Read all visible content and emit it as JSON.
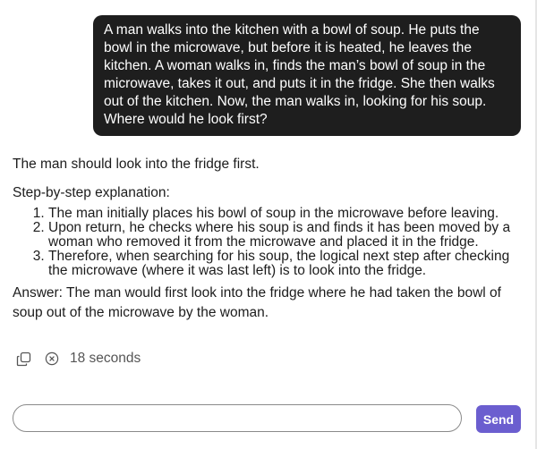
{
  "user_message": "A man walks into the kitchen with a bowl of soup. He puts the bowl in the microwave, but before it is heated, he leaves the kitchen. A woman walks in, finds the man’s bowl of soup in the microwave, takes it out, and puts it in the fridge. She then walks out of the kitchen. Now, the man walks in, looking for his soup. Where would he look first?",
  "assistant": {
    "intro": "The man should look into the fridge first.",
    "steps_heading": "Step-by-step explanation:",
    "steps": [
      "The man initially places his bowl of soup in the microwave before leaving.",
      "Upon return, he checks where his soup is and finds it has been moved by a woman who removed it from the microwave and placed it in the fridge.",
      "Therefore, when searching for his soup, the logical next step after checking the microwave (where it was last left) is to look into the fridge."
    ],
    "answer": "Answer: The man would first look into the fridge where he had taken the bowl of soup out of the microwave by the woman."
  },
  "meta": {
    "copy_icon": "copy-icon",
    "timer_icon": "circle-x-icon",
    "elapsed": "18 seconds"
  },
  "composer": {
    "value": "",
    "placeholder": "",
    "send_label": "Send"
  },
  "colors": {
    "user_bubble": "#1e1e1e",
    "send_button": "#6b5ecf"
  }
}
